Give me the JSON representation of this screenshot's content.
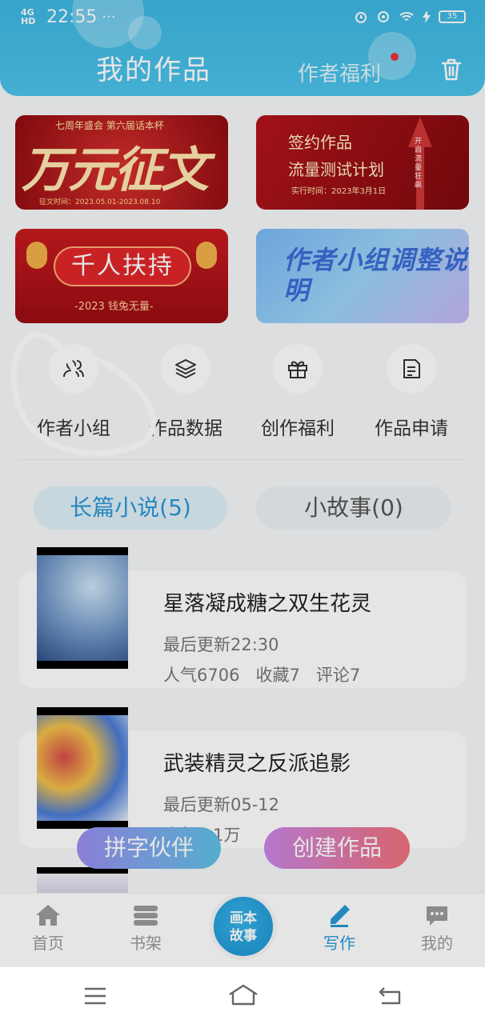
{
  "status_bar": {
    "network": "4G HD",
    "time": "22:55",
    "dots": "···",
    "battery": "35"
  },
  "header": {
    "title": "我的作品",
    "welfare_label": "作者福利"
  },
  "banners": [
    {
      "top": "七周年盛会  第六届话本杯",
      "main": "万元征文",
      "date": "征文时间：2023.05.01-2023.08.10"
    },
    {
      "line1": "签约作品",
      "line2": "流量测试计划",
      "date": "实行时间：2023年3月1日",
      "side": "开启流量狂飙"
    },
    {
      "main": "千人扶持",
      "sub": "-2023 钱兔无量-"
    },
    {
      "text": "作者小组调整说明"
    }
  ],
  "shortcuts": [
    {
      "label": "作者小组",
      "icon": "people-icon"
    },
    {
      "label": "作品数据",
      "icon": "layers-icon"
    },
    {
      "label": "创作福利",
      "icon": "gift-icon"
    },
    {
      "label": "作品申请",
      "icon": "document-icon"
    }
  ],
  "tabs": {
    "long": "长篇小说(5)",
    "short": "小故事(0)"
  },
  "books": [
    {
      "title": "星落凝成糖之双生花灵",
      "update": "最后更新22:30",
      "popularity": "人气6706",
      "favorites": "收藏7",
      "comments": "评论7"
    },
    {
      "title": "武装精灵之反派追影",
      "update": "最后更新05-12",
      "popularity": "人气1.1万"
    }
  ],
  "floating": {
    "partner": "拼字伙伴",
    "create": "创建作品"
  },
  "bottom_nav": {
    "home": "首页",
    "shelf": "书架",
    "center_line1": "画本",
    "center_line2": "故事",
    "write": "写作",
    "mine": "我的"
  },
  "colors": {
    "accent": "#2a97d6",
    "header": "#3db6e3",
    "red_dot": "#e8333b"
  }
}
